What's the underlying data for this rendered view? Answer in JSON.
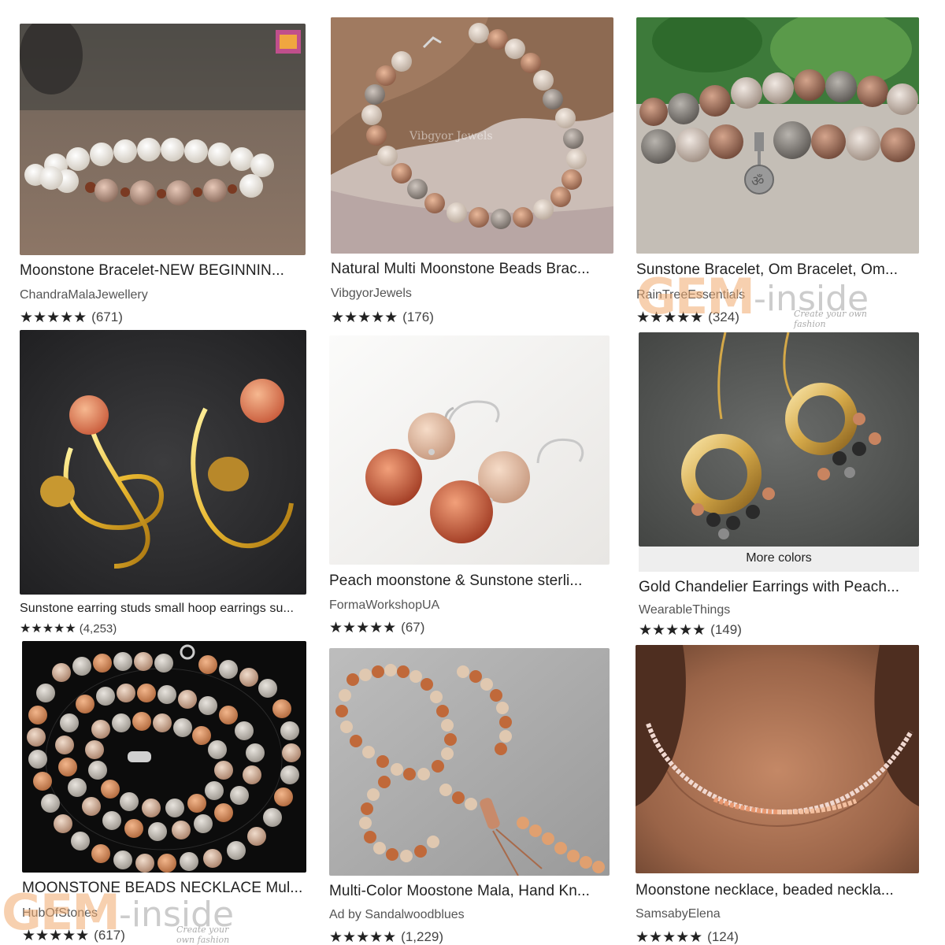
{
  "products": [
    {
      "title": "Moonstone Bracelet-NEW BEGINNIN...",
      "shop": "ChandraMalaJewellery",
      "stars": "★★★★★",
      "count": "(671)"
    },
    {
      "title": "Natural Multi Moonstone Beads Brac...",
      "shop": "VibgyorJewels",
      "stars": "★★★★★",
      "count": "(176)"
    },
    {
      "title": "Sunstone Bracelet, Om Bracelet, Om...",
      "shop": "RainTreeEssentials",
      "stars": "★★★★★",
      "count": "(324)"
    },
    {
      "title": "Sunstone earring studs small hoop earrings su...",
      "shop": "",
      "stars": "★★★★★",
      "count": "(4,253)"
    },
    {
      "title": "Peach moonstone & Sunstone sterli...",
      "shop": "FormaWorkshopUA",
      "stars": "★★★★★",
      "count": "(67)"
    },
    {
      "title": "Gold Chandelier Earrings with Peach...",
      "shop": "WearableThings",
      "stars": "★★★★★",
      "count": "(149)",
      "badge": "More colors"
    },
    {
      "title": "MOONSTONE BEADS NECKLACE Mul...",
      "shop": "HubOfStones",
      "stars": "★★★★★",
      "count": "(617)"
    },
    {
      "title": "Multi-Color Moostone Mala, Hand Kn...",
      "shop": "Ad by Sandalwoodblues",
      "stars": "★★★★★",
      "count": "(1,229)"
    },
    {
      "title": "Moonstone necklace, beaded neckla...",
      "shop": "SamsabyElena",
      "stars": "★★★★★",
      "count": "(124)"
    }
  ],
  "image_watermark_text": "Vibgyor Jewels",
  "watermark": {
    "brand": "GEM",
    "suffix": "-inside",
    "tagline": "Create your own fashion"
  }
}
